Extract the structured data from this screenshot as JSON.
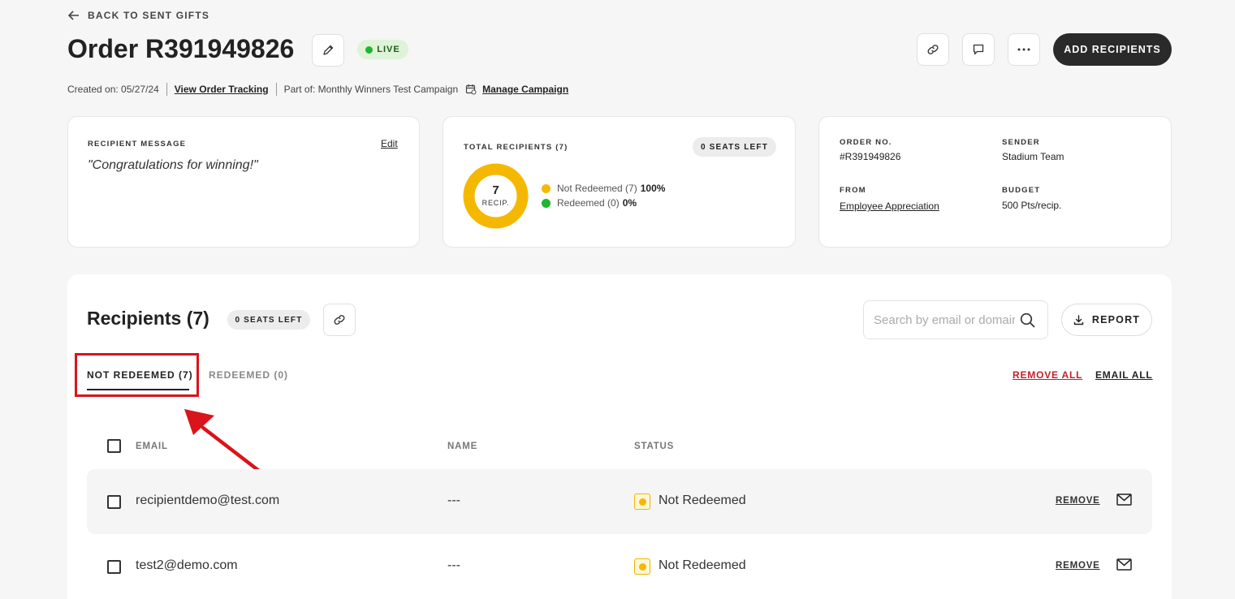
{
  "header": {
    "back_label": "BACK TO SENT GIFTS",
    "title": "Order R391949826",
    "status_badge": "LIVE",
    "add_recipients": "ADD RECIPIENTS",
    "created_on": "Created on: 05/27/24",
    "view_tracking": "View Order Tracking",
    "part_of": "Part of: Monthly Winners Test Campaign",
    "manage_campaign": "Manage Campaign"
  },
  "message_card": {
    "label": "RECIPIENT MESSAGE",
    "edit": "Edit",
    "message": "\"Congratulations for winning!\""
  },
  "recipients_card": {
    "label": "TOTAL RECIPIENTS (7)",
    "seats_left": "0 SEATS LEFT",
    "donut_count": "7",
    "donut_unit": "RECIP.",
    "legend": [
      {
        "label": "Not Redeemed (7)",
        "pct": "100%",
        "color": "#f5b800",
        "value": 7
      },
      {
        "label": "Redeemed (0)",
        "pct": "0%",
        "color": "#1fb52f",
        "value": 0
      }
    ]
  },
  "order_card": {
    "order_no_label": "ORDER NO.",
    "order_no": "#R391949826",
    "sender_label": "SENDER",
    "sender": "Stadium Team",
    "from_label": "FROM",
    "from": "Employee Appreciation",
    "budget_label": "BUDGET",
    "budget": "500 Pts/recip."
  },
  "recipients_section": {
    "title": "Recipients (7)",
    "seats_left": "0 SEATS LEFT",
    "search_placeholder": "Search by email or domain",
    "report": "REPORT",
    "tabs": [
      {
        "label": "NOT REDEEMED (7)",
        "active": true
      },
      {
        "label": "REDEEMED (0)",
        "active": false
      }
    ],
    "remove_all": "REMOVE ALL",
    "email_all": "EMAIL ALL",
    "columns": {
      "email": "EMAIL",
      "name": "NAME",
      "status": "STATUS"
    },
    "rows": [
      {
        "email": "recipientdemo@test.com",
        "name": "---",
        "status": "Not Redeemed",
        "remove": "REMOVE"
      },
      {
        "email": "test2@demo.com",
        "name": "---",
        "status": "Not Redeemed",
        "remove": "REMOVE"
      }
    ]
  },
  "colors": {
    "accent_dark": "#2a2a2a",
    "not_redeemed": "#f5b800",
    "redeemed": "#1fb52f",
    "remove_all": "#c4202a",
    "highlight": "#d9141a"
  }
}
